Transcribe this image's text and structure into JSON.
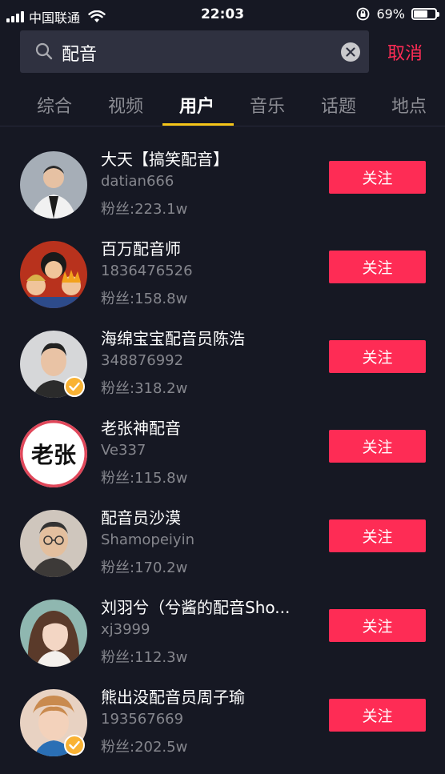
{
  "status_bar": {
    "carrier": "中国联通",
    "time": "22:03",
    "battery": "69%",
    "battery_level": 0.69
  },
  "search": {
    "query": "配音",
    "cancel_label": "取消"
  },
  "tabs": [
    {
      "label": "综合",
      "active": false
    },
    {
      "label": "视频",
      "active": false
    },
    {
      "label": "用户",
      "active": true
    },
    {
      "label": "音乐",
      "active": false
    },
    {
      "label": "话题",
      "active": false
    },
    {
      "label": "地点",
      "active": false
    }
  ],
  "users": [
    {
      "name": "大天【搞笑配音】",
      "id": "datian666",
      "fans": "粉丝:223.1w",
      "follow_label": "关注",
      "verified": false,
      "avatar_color": "#9aa3ad"
    },
    {
      "name": "百万配音师",
      "id": "1836476526",
      "fans": "粉丝:158.8w",
      "follow_label": "关注",
      "verified": false,
      "avatar_color": "#c8361f"
    },
    {
      "name": "海绵宝宝配音员陈浩",
      "id": "348876992",
      "fans": "粉丝:318.2w",
      "follow_label": "关注",
      "verified": true,
      "avatar_color": "#d9d9d9"
    },
    {
      "name": "老张神配音",
      "id": "Ve337",
      "fans": "粉丝:115.8w",
      "follow_label": "关注",
      "verified": false,
      "avatar_color": "#ffffff",
      "avatar_text": "老张"
    },
    {
      "name": "配音员沙漠",
      "id": "Shamopeiyin",
      "fans": "粉丝:170.2w",
      "follow_label": "关注",
      "verified": false,
      "avatar_color": "#c4b3a3"
    },
    {
      "name": "刘羽兮（兮酱的配音Sho...",
      "id": "xj3999",
      "fans": "粉丝:112.3w",
      "follow_label": "关注",
      "verified": false,
      "avatar_color": "#d8b8a5"
    },
    {
      "name": "熊出没配音员周子瑜",
      "id": "193567669",
      "fans": "粉丝:202.5w",
      "follow_label": "关注",
      "verified": true,
      "avatar_color": "#e2c1a8"
    }
  ],
  "colors": {
    "background": "#161823",
    "accent": "#fe2c55",
    "tab_indicator": "#f5c518",
    "verified_badge": "#f9b233"
  }
}
